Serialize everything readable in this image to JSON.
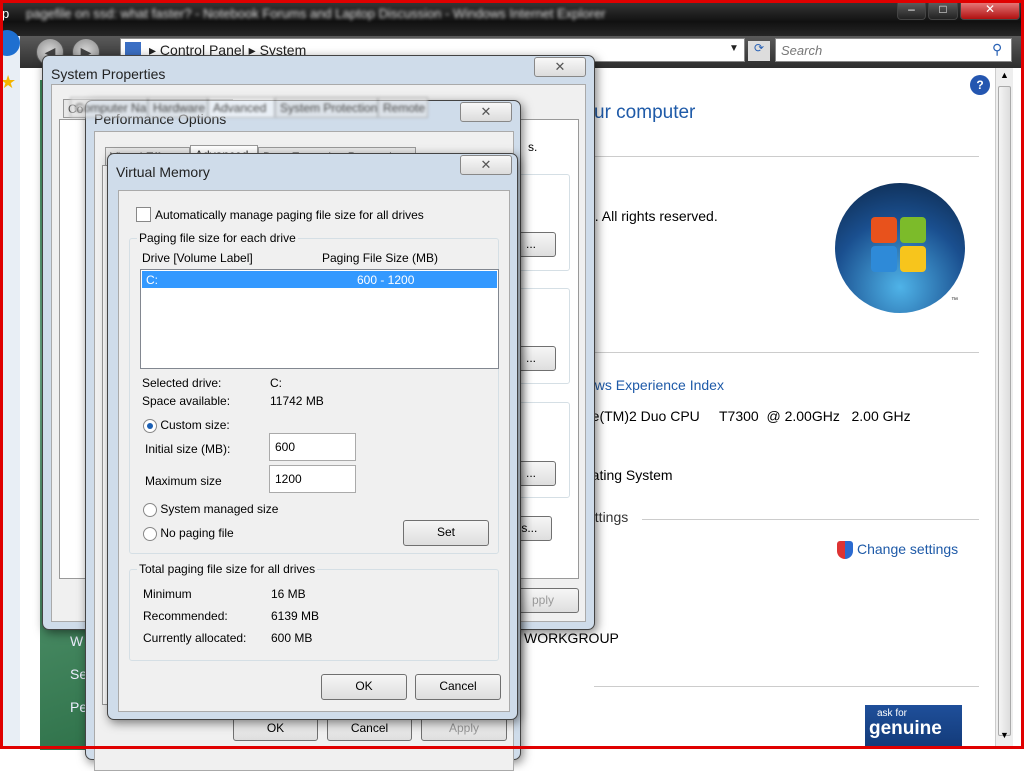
{
  "ie": {
    "title": "pagefile on ssd: what faster? - Notebook Forums and Laptop Discussion - Windows Internet Explorer",
    "title_visible": "p",
    "breadcrumb": [
      "Control Panel",
      "System"
    ],
    "search_placeholder": "Search",
    "min": "–",
    "max": "□",
    "close": "✕"
  },
  "page": {
    "heading": "ur computer",
    "copyright": "n.  All rights reserved.",
    "wei_link": "ows Experience Index",
    "cpu": "re(TM)2 Duo CPU     T7300  @ 2.00GHz   2.00 GHz",
    "os": "rating System",
    "section_settings": "ettings",
    "change_settings": "Change settings",
    "workgroup": "WORKGROUP",
    "genuine_top": "ask for",
    "genuine": "genuine",
    "tm": "™",
    "left_nav": [
      "W",
      "Se",
      "Pe"
    ]
  },
  "sysprops": {
    "title": "System Properties",
    "tab_visible": "Co",
    "tabs": [
      "Computer Name",
      "Hardware",
      "Advanced",
      "System Protection",
      "Remote"
    ],
    "partial_text": "s.",
    "apply": "pply",
    "btn_dots": "...",
    "btn_es": "es..."
  },
  "perf": {
    "title": "Performance Options",
    "tabs": [
      "Visual Effects",
      "Advanced",
      "Data Execution Prevention"
    ],
    "ok": "OK",
    "cancel": "Cancel",
    "apply": "Apply"
  },
  "vm": {
    "title": "Virtual Memory",
    "auto_manage": "Automatically manage paging file size for all drives",
    "auto_checked": false,
    "group1": "Paging file size for each drive",
    "col_drive": "Drive  [Volume Label]",
    "col_size": "Paging File Size (MB)",
    "drives": [
      {
        "drive": "C:",
        "size": "600 - 1200"
      }
    ],
    "selected_drive_label": "Selected drive:",
    "selected_drive": "C:",
    "space_label": "Space available:",
    "space": "11742 MB",
    "custom": "Custom size:",
    "initial_label": "Initial size (MB):",
    "initial": "600",
    "max_label": "Maximum size",
    "max": "1200",
    "system_managed": "System managed size",
    "no_paging": "No paging file",
    "set": "Set",
    "group2": "Total paging file size for all drives",
    "min_label": "Minimum",
    "min": "16 MB",
    "rec_label": "Recommended:",
    "rec": "6139 MB",
    "cur_label": "Currently allocated:",
    "cur": "600 MB",
    "ok": "OK",
    "cancel": "Cancel"
  }
}
